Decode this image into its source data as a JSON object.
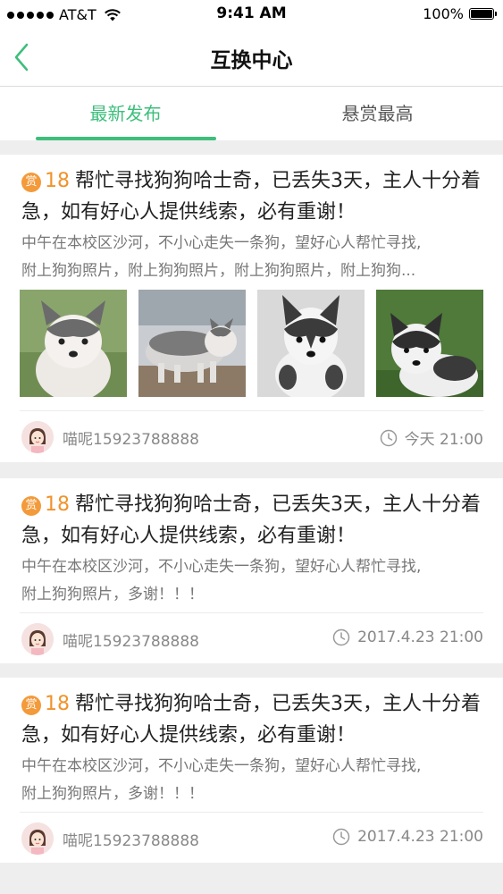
{
  "status_bar": {
    "carrier": "AT&T",
    "time": "9:41 AM",
    "battery": "100%"
  },
  "nav": {
    "title": "互换中心",
    "back_icon": "chevron-left-icon"
  },
  "tabs": [
    {
      "label": "最新发布",
      "active": true
    },
    {
      "label": "悬赏最高",
      "active": false
    }
  ],
  "colors": {
    "accent": "#3dbe7b",
    "reward": "#f39a3a"
  },
  "posts": [
    {
      "reward_badge": "赏",
      "reward_amount": "18",
      "title": "帮忙寻找狗狗哈士奇，已丢失3天，主人十分着急，如有好心人提供线索，必有重谢！",
      "desc_lines": [
        "中午在本校区沙河，不小心走失一条狗，望好心人帮忙寻找,",
        "附上狗狗照片，附上狗狗照片，附上狗狗照片，附上狗狗..."
      ],
      "photos": [
        "husky-puppy-photo",
        "husky-puppy-photo",
        "husky-puppy-photo",
        "husky-puppy-photo"
      ],
      "username": "喵呢15923788888",
      "time": "今天 21:00"
    },
    {
      "reward_badge": "赏",
      "reward_amount": "18",
      "title": "帮忙寻找狗狗哈士奇，已丢失3天，主人十分着急，如有好心人提供线索，必有重谢！",
      "desc_lines": [
        "中午在本校区沙河，不小心走失一条狗，望好心人帮忙寻找,",
        "附上狗狗照片，多谢！！！"
      ],
      "username": "喵呢15923788888",
      "time": "2017.4.23 21:00"
    },
    {
      "reward_badge": "赏",
      "reward_amount": "18",
      "title": "帮忙寻找狗狗哈士奇，已丢失3天，主人十分着急，如有好心人提供线索，必有重谢！",
      "desc_lines": [
        "中午在本校区沙河，不小心走失一条狗，望好心人帮忙寻找,",
        "附上狗狗照片，多谢！！！"
      ],
      "username": "喵呢15923788888",
      "time": "2017.4.23 21:00"
    }
  ]
}
